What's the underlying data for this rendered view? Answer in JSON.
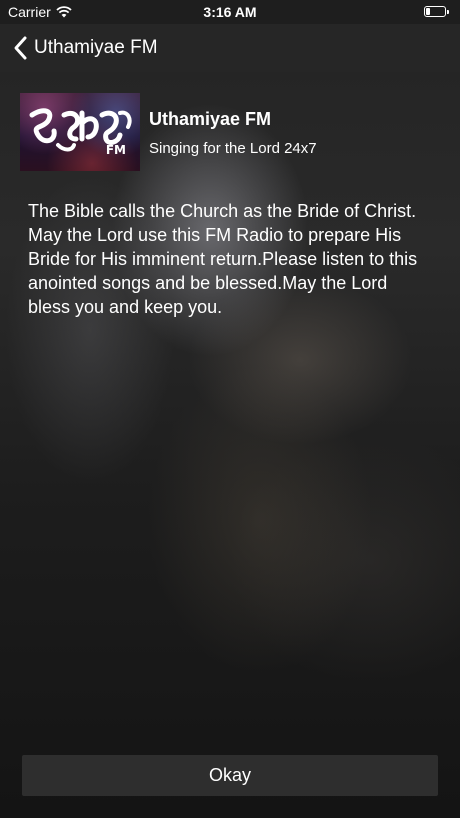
{
  "status_bar": {
    "carrier": "Carrier",
    "time": "3:16 AM",
    "icons": [
      "wifi-icon",
      "battery-icon"
    ]
  },
  "nav": {
    "back_label": "Uthamiyae FM",
    "back_icon": "chevron-left-icon"
  },
  "station": {
    "logo_label": "FM",
    "name": "Uthamiyae FM",
    "tagline": "Singing for the Lord 24x7"
  },
  "description": "The Bible calls the Church as the Bride of Christ. May the Lord use this FM Radio to prepare His Bride for His imminent return.Please listen to this anointed songs and be blessed.May the Lord bless you and keep you.",
  "actions": {
    "okay_label": "Okay"
  },
  "colors": {
    "nav_background": "#262626",
    "button_background": "#2e2e2e",
    "text": "#ffffff"
  }
}
